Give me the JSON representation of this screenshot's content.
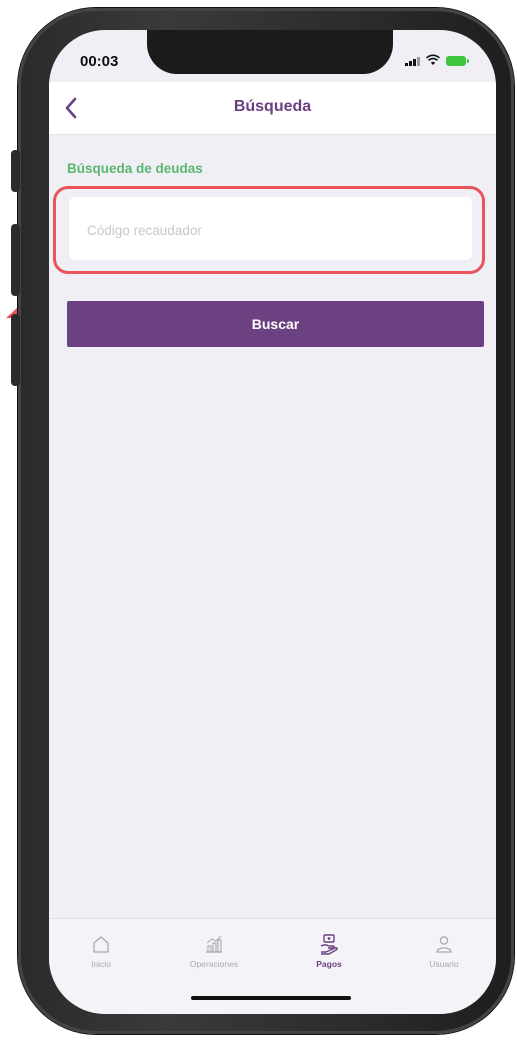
{
  "status_bar": {
    "time": "00:03"
  },
  "navbar": {
    "title": "Búsqueda"
  },
  "form": {
    "section_title": "Búsqueda de deudas",
    "code_input": {
      "placeholder": "Código recaudador",
      "value": ""
    },
    "search_button_label": "Buscar"
  },
  "tabbar": {
    "tabs": [
      {
        "label": "Inicio",
        "icon": "home-icon",
        "active": false
      },
      {
        "label": "Operaciones",
        "icon": "chart-icon",
        "active": false
      },
      {
        "label": "Pagos",
        "icon": "payment-icon",
        "active": true
      },
      {
        "label": "Usuario",
        "icon": "user-icon",
        "active": false
      }
    ]
  },
  "colors": {
    "brand_purple": "#6b4181",
    "section_green": "#59b66f",
    "highlight_red": "#e8555a",
    "screen_bg": "#f0eff6"
  }
}
